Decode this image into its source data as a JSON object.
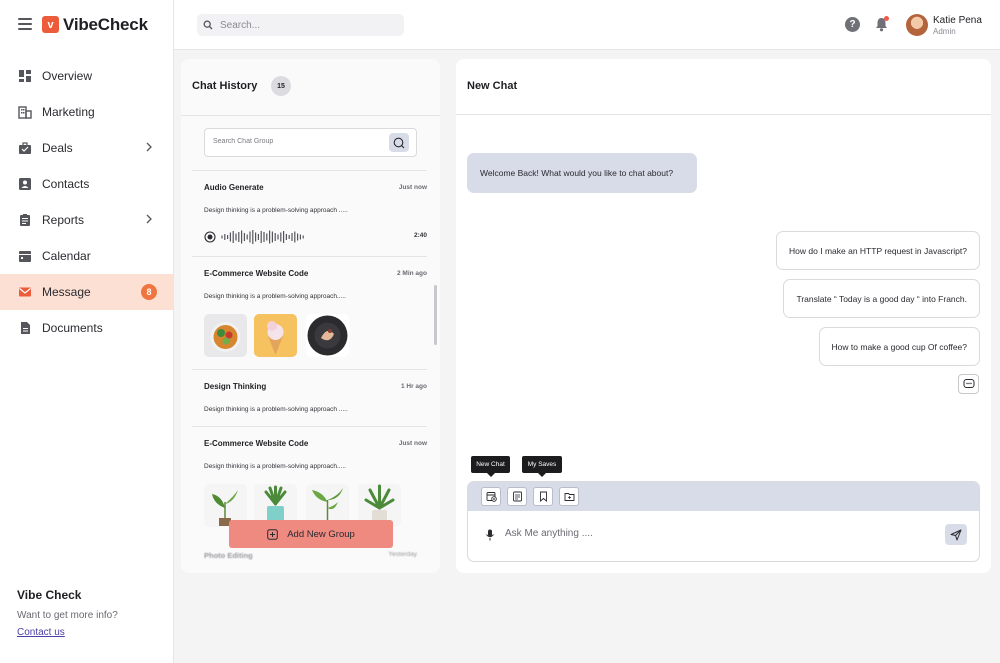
{
  "brand": {
    "name": "VibeCheck",
    "logo_glyph": "v"
  },
  "nav": [
    {
      "label": "Overview",
      "icon": "grid-icon"
    },
    {
      "label": "Marketing",
      "icon": "building-icon"
    },
    {
      "label": "Deals",
      "icon": "briefcase-icon",
      "chevron": true
    },
    {
      "label": "Contacts",
      "icon": "contact-card-icon"
    },
    {
      "label": "Reports",
      "icon": "clipboard-icon",
      "chevron": true
    },
    {
      "label": "Calendar",
      "icon": "calendar-icon"
    },
    {
      "label": "Message",
      "icon": "mail-icon",
      "badge": "8",
      "active": true
    },
    {
      "label": "Documents",
      "icon": "document-icon"
    }
  ],
  "sidebar_footer": {
    "title": "Vibe Check",
    "subtitle": "Want to get more info?",
    "link": "Contact us"
  },
  "header": {
    "search_placeholder": "Search...",
    "help_glyph": "?",
    "user": {
      "name": "Katie Pena",
      "role": "Admin"
    }
  },
  "history": {
    "title": "Chat History",
    "count": "15",
    "search_placeholder": "Search Chat Group",
    "entries": [
      {
        "title": "Audio Generate",
        "time": "Just now",
        "desc": "Design thinking is a problem-solving approach .....",
        "audio_duration": "2:40"
      },
      {
        "title": "E-Commerce Website Code",
        "time": "2 Min ago",
        "desc": "Design thinking is a problem-solving approach....."
      },
      {
        "title": "Design Thinking",
        "time": "1 Hr ago",
        "desc": "Design thinking is a problem-solving approach ....."
      },
      {
        "title": "E-Commerce Website Code",
        "time": "Just now",
        "desc": "Design thinking is a problem-solving approach....."
      }
    ],
    "faded_entry": {
      "title": "Photo Editing",
      "time": "Yesterday"
    },
    "add_group_label": "Add New Group"
  },
  "chat": {
    "title": "New Chat",
    "bot_message": "Welcome Back! What would you like to chat about?",
    "user_messages": [
      "How do I make an HTTP request in Javascript?",
      "Translate “ Today is a good day “ into Franch.",
      "How to make a good cup Of coffee?"
    ],
    "tooltips": {
      "new_chat": "New Chat",
      "my_saves": "My Saves"
    },
    "input_placeholder": "Ask Me anything ...."
  },
  "colors": {
    "accent": "#ec5b3a",
    "active_bg": "#fde0d4",
    "badge": "#ef7540",
    "bubble": "#d8dce8",
    "add_group": "#ee8a80"
  }
}
